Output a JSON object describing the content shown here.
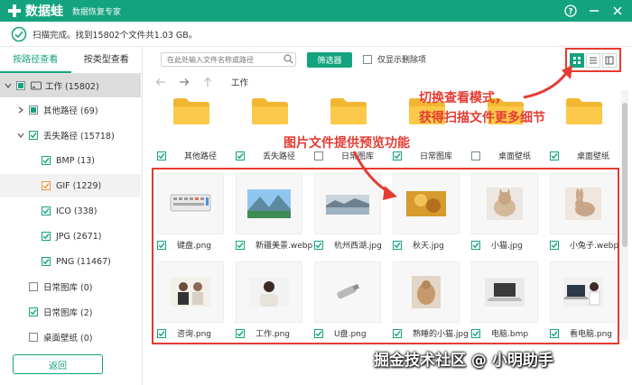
{
  "app": {
    "name": "数据蛙",
    "subtitle": "数据恢复专家"
  },
  "status": {
    "text": "扫描完成。找到15802个文件共1.03 GB。"
  },
  "sidebar": {
    "tabs": [
      {
        "label": "按路径查看",
        "active": true
      },
      {
        "label": "按类型查看",
        "active": false
      }
    ],
    "tree": [
      {
        "label": "工作 (15802)",
        "level": 0
      },
      {
        "label": "其他路径 (69)",
        "level": 1
      },
      {
        "label": "丢失路径 (15718)",
        "level": 1
      },
      {
        "label": "BMP (13)",
        "level": 2
      },
      {
        "label": "GIF (1229)",
        "level": 2
      },
      {
        "label": "ICO (338)",
        "level": 2
      },
      {
        "label": "JPG (2671)",
        "level": 2
      },
      {
        "label": "PNG (11467)",
        "level": 2
      },
      {
        "label": "日常图库 (0)",
        "level": 1
      },
      {
        "label": "日常图库 (2)",
        "level": 1
      },
      {
        "label": "桌面壁纸 (0)",
        "level": 1
      }
    ],
    "back_label": "返回"
  },
  "toolbar": {
    "search_placeholder": "在此处输入文件名称或路径",
    "filter_label": "筛选器",
    "only_deleted_label": "仅显示删除项"
  },
  "nav": {
    "breadcrumb": "工作"
  },
  "folders": [
    {
      "label": "其他路径"
    },
    {
      "label": "丢失路径"
    },
    {
      "label": "日常图库"
    },
    {
      "label": "日常图库"
    },
    {
      "label": "桌面壁纸"
    },
    {
      "label": "桌面壁纸"
    }
  ],
  "files": [
    {
      "label": "键盘.png",
      "icon": "keyboard-image"
    },
    {
      "label": "新疆美景.webp",
      "icon": "landscape-image"
    },
    {
      "label": "杭州西湖.jpg",
      "icon": "lake-image"
    },
    {
      "label": "秋天.jpg",
      "icon": "autumn-image"
    },
    {
      "label": "小猫.jpg",
      "icon": "kitten-image"
    },
    {
      "label": "小兔子.webp",
      "icon": "rabbit-image"
    },
    {
      "label": "咨询.png",
      "icon": "consulting-image"
    },
    {
      "label": "工作.png",
      "icon": "office-worker-image"
    },
    {
      "label": "U盘.png",
      "icon": "usb-drive-image"
    },
    {
      "label": "熟睡的小猫.jpg",
      "icon": "sleeping-kitten-image"
    },
    {
      "label": "电脑.bmp",
      "icon": "laptop-image"
    },
    {
      "label": "看电脑.png",
      "icon": "watching-laptop-image"
    }
  ],
  "annotations": {
    "view_mode_line1": "切换查看模式，",
    "view_mode_line2": "获得扫描文件更多细节",
    "preview": "图片文件提供预览功能"
  },
  "watermark": "掘金技术社区 @ 小明助手",
  "colors": {
    "brand": "#14a37f",
    "annotation": "#e53b32"
  }
}
